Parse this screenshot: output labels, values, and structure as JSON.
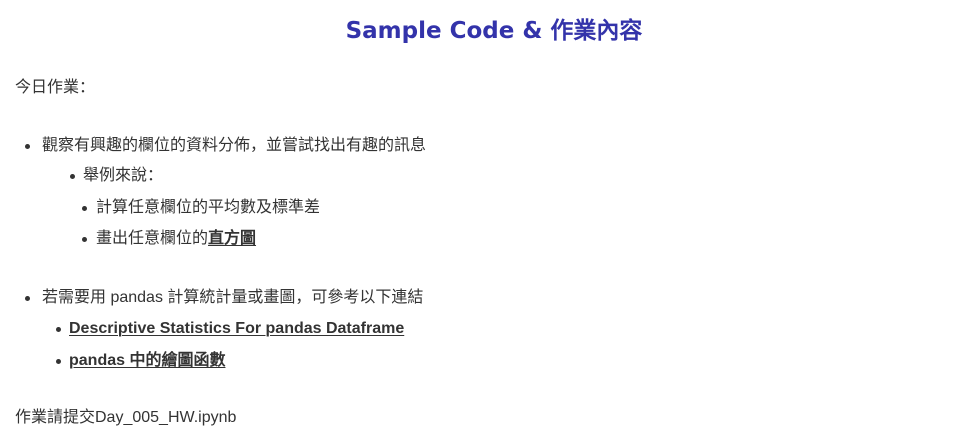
{
  "title": "Sample Code & 作業內容",
  "intro": "今日作業：",
  "items": {
    "observe": "觀察有興趣的欄位的資料分佈，並嘗試找出有趣的訊息",
    "example": "舉例來說：",
    "calc_text": "計算任意欄位的平均數及標準差",
    "plot_prefix": "畫出任意欄位的",
    "plot_link": "直方圖",
    "pandas_hint": "若需要用 pandas 計算統計量或畫圖，可參考以下連結",
    "link_1": "Descriptive Statistics For pandas Dataframe",
    "link_2": "pandas 中的繪圖函數"
  },
  "submit": "作業請提交Day_005_HW.ipynb"
}
